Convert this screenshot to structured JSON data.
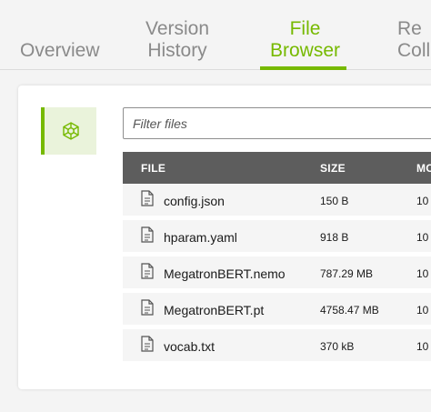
{
  "tabs": [
    {
      "line1": "",
      "line2": "Overview",
      "active": false
    },
    {
      "line1": "Version",
      "line2": "History",
      "active": false
    },
    {
      "line1": "File",
      "line2": "Browser",
      "active": true
    },
    {
      "line1": "Re",
      "line2": "Coll",
      "active": false
    }
  ],
  "filter": {
    "placeholder": "Filter files"
  },
  "table": {
    "headers": {
      "file": "FILE",
      "size": "SIZE",
      "modified": "MO"
    },
    "rows": [
      {
        "name": "config.json",
        "size": "150 B",
        "modified": "10"
      },
      {
        "name": "hparam.yaml",
        "size": "918 B",
        "modified": "10"
      },
      {
        "name": "MegatronBERT.nemo",
        "size": "787.29 MB",
        "modified": "10"
      },
      {
        "name": "MegatronBERT.pt",
        "size": "4758.47 MB",
        "modified": "10"
      },
      {
        "name": "vocab.txt",
        "size": "370 kB",
        "modified": "10"
      }
    ]
  },
  "colors": {
    "accent": "#76b900",
    "header_bg": "#5d5d5d",
    "row_bg": "#f5f5f5"
  },
  "icons": {
    "side_tab": "network-graph-icon",
    "file": "document-icon"
  }
}
